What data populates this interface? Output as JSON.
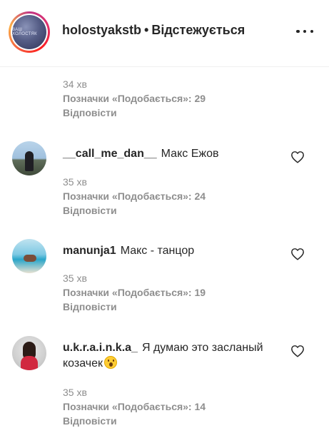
{
  "header": {
    "username": "holostyakstb",
    "separator": "•",
    "follow_status": "Відстежується",
    "avatar_text": "ВАШ ХОЛОСТЯК"
  },
  "comments": [
    {
      "time": "34 хв",
      "likes": "Позначки «Подобається»: 29",
      "reply": "Відповісти"
    },
    {
      "username": "__call_me_dan__",
      "text": "Макс Ежов",
      "time": "35 хв",
      "likes": "Позначки «Подобається»: 24",
      "reply": "Відповісти"
    },
    {
      "username": "manunja1",
      "text": "Макс - танцор",
      "time": "35 хв",
      "likes": "Позначки «Подобається»: 19",
      "reply": "Відповісти"
    },
    {
      "username": "u.k.r.a.i.n.k.a_",
      "text": "Я думаю это засланый козачек",
      "time": "35 хв",
      "likes": "Позначки «Подобається»: 14",
      "reply": "Відповісти"
    }
  ],
  "icons": {
    "more": "more-options-icon",
    "heart": "heart-icon",
    "emoji": "surprised-face-emoji"
  },
  "colors": {
    "text": "#262626",
    "secondary": "#8e8e8e",
    "divider": "#efefef"
  }
}
